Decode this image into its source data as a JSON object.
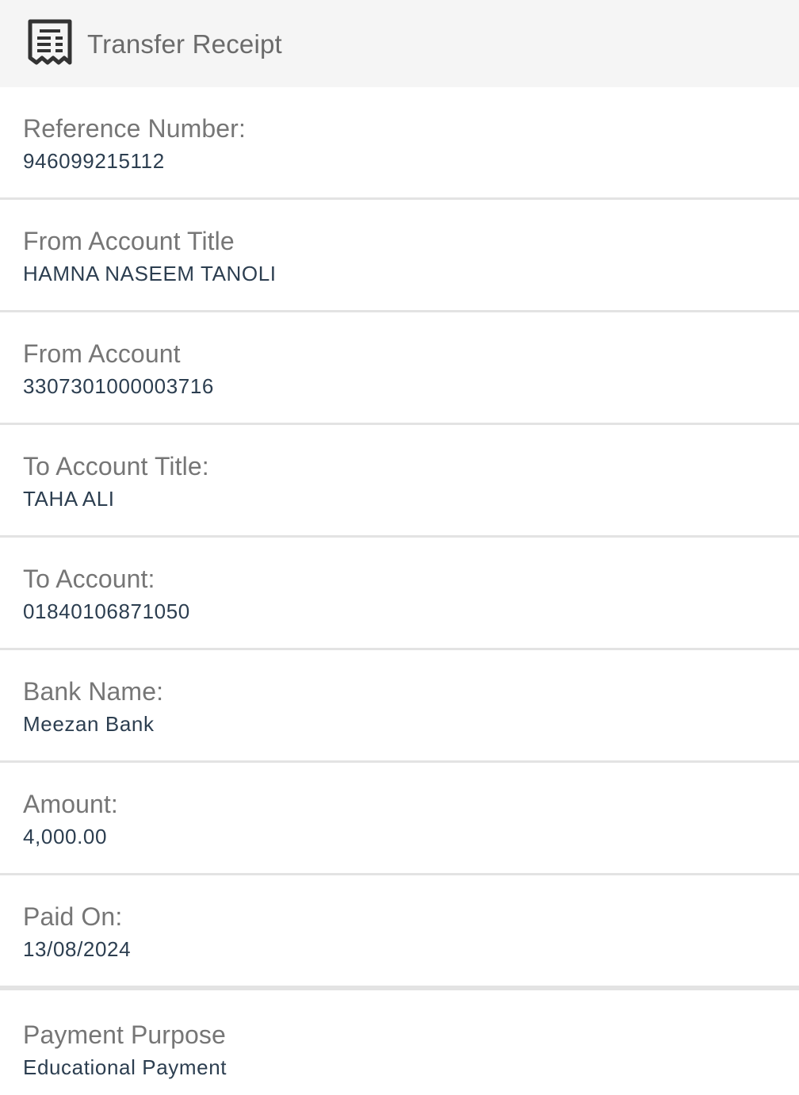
{
  "header": {
    "title": "Transfer Receipt",
    "icon": "receipt-icon"
  },
  "fields": [
    {
      "label": "Reference Number:",
      "value": "946099215112"
    },
    {
      "label": "From Account Title",
      "value": "HAMNA NASEEM TANOLI"
    },
    {
      "label": "From Account",
      "value": "3307301000003716"
    },
    {
      "label": "To Account Title:",
      "value": "TAHA ALI"
    },
    {
      "label": "To Account:",
      "value": "01840106871050"
    },
    {
      "label": "Bank Name:",
      "value": "Meezan Bank"
    },
    {
      "label": "Amount:",
      "value": "4,000.00"
    },
    {
      "label": "Paid On:",
      "value": "13/08/2024"
    },
    {
      "label": "Payment Purpose",
      "value": "Educational Payment"
    }
  ],
  "colors": {
    "header_bg": "#f5f5f5",
    "label": "#767676",
    "value": "#2c3e50",
    "divider": "#e3e3e3"
  }
}
